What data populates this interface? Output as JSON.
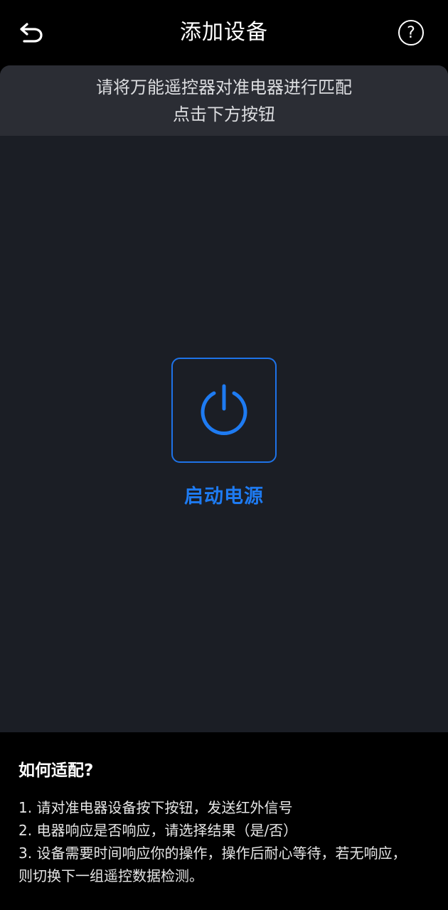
{
  "header": {
    "title": "添加设备",
    "back_icon": "back-arrow-icon",
    "help_icon": "help-circle-icon",
    "help_glyph": "?"
  },
  "instruction": {
    "line1": "请将万能遥控器对准电器进行匹配",
    "line2": "点击下方按钮"
  },
  "power": {
    "icon": "power-icon",
    "label": "启动电源",
    "color": "#1E7BF2"
  },
  "help": {
    "title": "如何适配?",
    "steps": [
      "1. 请对准电器设备按下按钮，发送红外信号",
      "2. 电器响应是否响应，请选择结果（是/否）",
      "3. 设备需要时间响应你的操作，操作后耐心等待，若无响应，则切换下一组遥控数据检测。"
    ]
  },
  "colors": {
    "background": "#000000",
    "panel": "#1B1E25",
    "instruction_bar": "#2B2D34",
    "accent": "#1E73E8"
  }
}
